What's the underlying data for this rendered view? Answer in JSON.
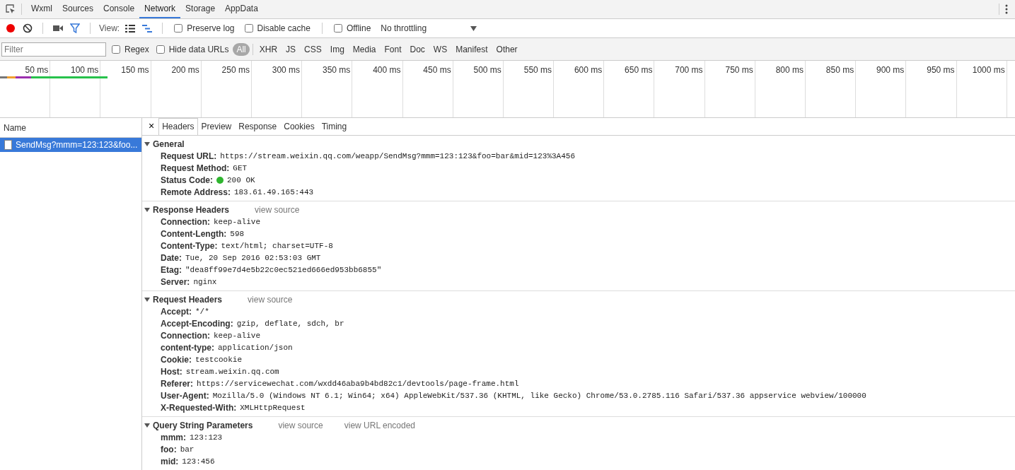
{
  "main_tabs": [
    {
      "label": "Wxml",
      "selected": false
    },
    {
      "label": "Sources",
      "selected": false
    },
    {
      "label": "Console",
      "selected": false
    },
    {
      "label": "Network",
      "selected": true
    },
    {
      "label": "Storage",
      "selected": false
    },
    {
      "label": "AppData",
      "selected": false
    }
  ],
  "toolbar": {
    "recording": true,
    "view_label": "View:",
    "options": [
      {
        "label": "Preserve log",
        "checked": false
      },
      {
        "label": "Disable cache",
        "checked": false
      },
      {
        "label": "Offline",
        "checked": false
      }
    ],
    "throttling": "No throttling"
  },
  "filter_bar": {
    "placeholder": "Filter",
    "options": [
      {
        "label": "Regex",
        "checked": false
      },
      {
        "label": "Hide data URLs",
        "checked": false
      }
    ],
    "types": [
      {
        "label": "All",
        "selected": true
      },
      {
        "label": "XHR",
        "selected": false
      },
      {
        "label": "JS",
        "selected": false
      },
      {
        "label": "CSS",
        "selected": false
      },
      {
        "label": "Img",
        "selected": false
      },
      {
        "label": "Media",
        "selected": false
      },
      {
        "label": "Font",
        "selected": false
      },
      {
        "label": "Doc",
        "selected": false
      },
      {
        "label": "WS",
        "selected": false
      },
      {
        "label": "Manifest",
        "selected": false
      },
      {
        "label": "Other",
        "selected": false
      }
    ]
  },
  "timeline": {
    "ticks": [
      "50 ms",
      "100 ms",
      "150 ms",
      "200 ms",
      "250 ms",
      "300 ms",
      "350 ms",
      "400 ms",
      "450 ms",
      "500 ms",
      "550 ms",
      "600 ms",
      "650 ms",
      "700 ms",
      "750 ms",
      "800 ms",
      "850 ms",
      "900 ms",
      "950 ms",
      "1000 ms"
    ]
  },
  "requests": {
    "header": "Name",
    "rows": [
      {
        "name": "SendMsg?mmm=123:123&foo...",
        "selected": true
      }
    ]
  },
  "detail": {
    "close": "×",
    "tabs": [
      {
        "label": "Headers",
        "selected": true
      },
      {
        "label": "Preview",
        "selected": false
      },
      {
        "label": "Response",
        "selected": false
      },
      {
        "label": "Cookies",
        "selected": false
      },
      {
        "label": "Timing",
        "selected": false
      }
    ],
    "sections": [
      {
        "title": "General",
        "expanded": true,
        "rows": [
          {
            "key": "Request URL:",
            "value": "https://stream.weixin.qq.com/weapp/SendMsg?mmm=123:123&foo=bar&mid=123%3A456",
            "kind": "plain"
          },
          {
            "key": "Request Method:",
            "value": "GET",
            "kind": "plain"
          },
          {
            "key": "Status Code:",
            "value": "200 OK",
            "kind": "status"
          },
          {
            "key": "Remote Address:",
            "value": "183.61.49.165:443",
            "kind": "plain"
          }
        ]
      },
      {
        "title": "Response Headers",
        "expanded": true,
        "links": [
          "view source"
        ],
        "rows": [
          {
            "key": "Connection:",
            "value": "keep-alive",
            "kind": "plain"
          },
          {
            "key": "Content-Length:",
            "value": "598",
            "kind": "plain"
          },
          {
            "key": "Content-Type:",
            "value": "text/html; charset=UTF-8",
            "kind": "plain"
          },
          {
            "key": "Date:",
            "value": "Tue, 20 Sep 2016 02:53:03 GMT",
            "kind": "plain"
          },
          {
            "key": "Etag:",
            "value": "\"dea8ff99e7d4e5b22c0ec521ed666ed953bb6855\"",
            "kind": "plain"
          },
          {
            "key": "Server:",
            "value": "nginx",
            "kind": "plain"
          }
        ]
      },
      {
        "title": "Request Headers",
        "expanded": true,
        "links": [
          "view source"
        ],
        "rows": [
          {
            "key": "Accept:",
            "value": "*/*",
            "kind": "plain"
          },
          {
            "key": "Accept-Encoding:",
            "value": "gzip, deflate, sdch, br",
            "kind": "plain"
          },
          {
            "key": "Connection:",
            "value": "keep-alive",
            "kind": "plain"
          },
          {
            "key": "content-type:",
            "value": "application/json",
            "kind": "plain"
          },
          {
            "key": "Cookie:",
            "value": "testcookie",
            "kind": "plain"
          },
          {
            "key": "Host:",
            "value": "stream.weixin.qq.com",
            "kind": "plain"
          },
          {
            "key": "Referer:",
            "value": "https://servicewechat.com/wxdd46aba9b4bd82c1/devtools/page-frame.html",
            "kind": "plain"
          },
          {
            "key": "User-Agent:",
            "value": "Mozilla/5.0 (Windows NT 6.1; Win64; x64) AppleWebKit/537.36 (KHTML, like Gecko) Chrome/53.0.2785.116 Safari/537.36 appservice webview/100000",
            "kind": "plain"
          },
          {
            "key": "X-Requested-With:",
            "value": "XMLHttpRequest",
            "kind": "plain"
          }
        ]
      },
      {
        "title": "Query String Parameters",
        "expanded": true,
        "links": [
          "view source",
          "view URL encoded"
        ],
        "rows": [
          {
            "key": "mmm:",
            "value": "123:123",
            "kind": "plain"
          },
          {
            "key": "foo:",
            "value": "bar",
            "kind": "plain"
          },
          {
            "key": "mid:",
            "value": "123:456",
            "kind": "plain"
          }
        ]
      }
    ]
  }
}
